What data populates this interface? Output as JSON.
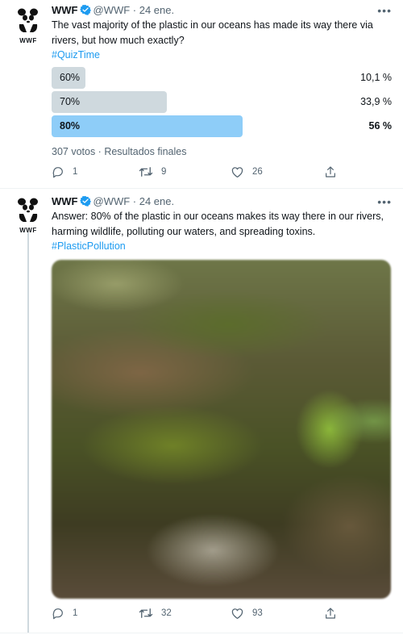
{
  "tweet1": {
    "name": "WWF",
    "handle": "@WWF",
    "time": "· 24 ene.",
    "text": "The vast majority of the plastic in our oceans has made its way there via rivers, but how much exactly?",
    "hashtag": "#QuizTime",
    "poll": {
      "options": [
        {
          "label": "60%",
          "result": "10,1 %",
          "share": 0.101,
          "winner": false
        },
        {
          "label": "70%",
          "result": "33,9 %",
          "share": 0.339,
          "winner": false
        },
        {
          "label": "80%",
          "result": "56 %",
          "share": 0.56,
          "winner": true
        }
      ],
      "summary": "307 votos · Resultados finales"
    },
    "actions": {
      "replies": "1",
      "retweets": "9",
      "likes": "26"
    }
  },
  "tweet2": {
    "name": "WWF",
    "handle": "@WWF",
    "time": "· 24 ene.",
    "text": "Answer: 80% of the plastic in our oceans makes its way there in our rivers, harming wildlife, polluting our waters, and spreading toxins.",
    "hashtag": "#PlasticPollution",
    "actions": {
      "replies": "1",
      "retweets": "32",
      "likes": "93"
    }
  },
  "logo": {
    "text": "WWF"
  },
  "colors": {
    "accent": "#1d9bf0",
    "winner_bar": "#8ecdf8",
    "loser_bar": "#cfd9de",
    "muted": "#536471"
  }
}
